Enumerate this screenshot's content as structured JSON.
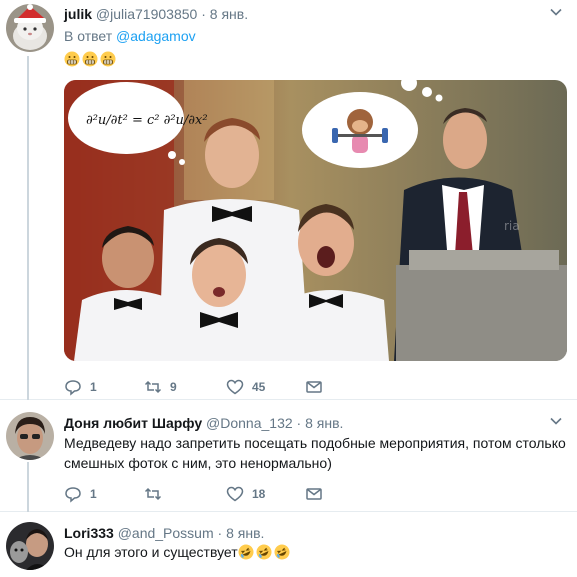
{
  "tweets": [
    {
      "name": "julik",
      "handle": "@julia71903850",
      "dot": "·",
      "date": "8 янв.",
      "reply_prefix": "В ответ",
      "reply_handle": "@adagamov",
      "emoji": [
        "grimacing",
        "grimacing",
        "grimacing"
      ],
      "photo_alt": "choir boys photo with speech bubbles",
      "actions": {
        "replies": "1",
        "retweets": "9",
        "likes": "45"
      }
    },
    {
      "name": "Доня любит Шарфу",
      "handle": "@Donna_132",
      "dot": "·",
      "date": "8 янв.",
      "text": "Медведеву надо запретить посещать подобные мероприятия, потом столько смешных фоток с ним, это ненормально)",
      "actions": {
        "replies": "1",
        "retweets": "",
        "likes": "18"
      }
    },
    {
      "name": "Lori333",
      "handle": "@and_Possum",
      "dot": "·",
      "date": "8 янв.",
      "text": "Он для этого и существует",
      "emoji": [
        "rofl",
        "rofl",
        "rofl"
      ]
    }
  ],
  "colors": {
    "link": "#1da1f2",
    "muted": "#657786",
    "border": "#e6ecf0",
    "thread_line": "#ccd6dd"
  }
}
